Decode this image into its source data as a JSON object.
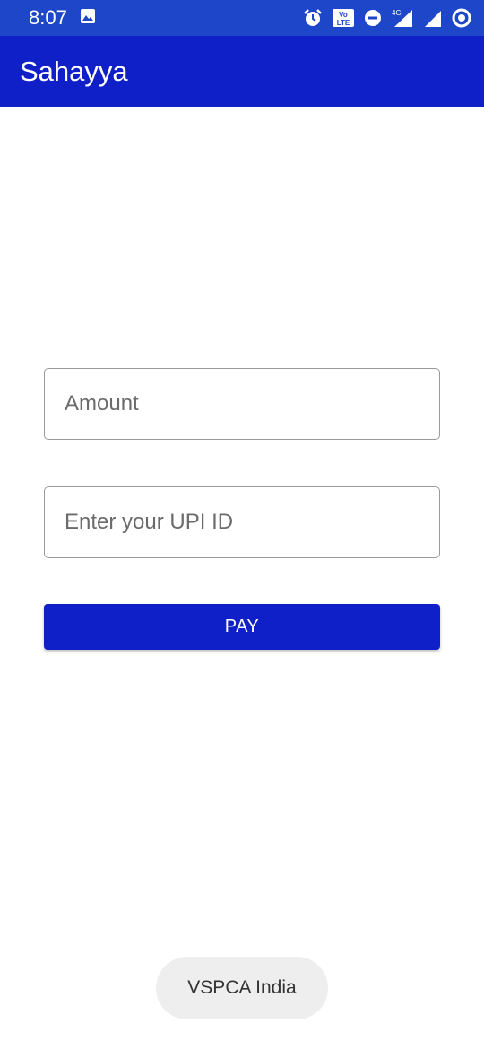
{
  "status_bar": {
    "time": "8:07",
    "network_label": "4G",
    "icons": [
      "image-icon",
      "alarm-icon",
      "volte-icon",
      "dnd-icon",
      "signal-icon",
      "signal-icon-2",
      "sync-icon"
    ]
  },
  "app_bar": {
    "title": "Sahayya",
    "color": "#1020c8"
  },
  "form": {
    "amount_placeholder": "Amount",
    "upi_placeholder": "Enter your UPI ID",
    "pay_label": "PAY"
  },
  "toast": {
    "text": "VSPCA India"
  }
}
